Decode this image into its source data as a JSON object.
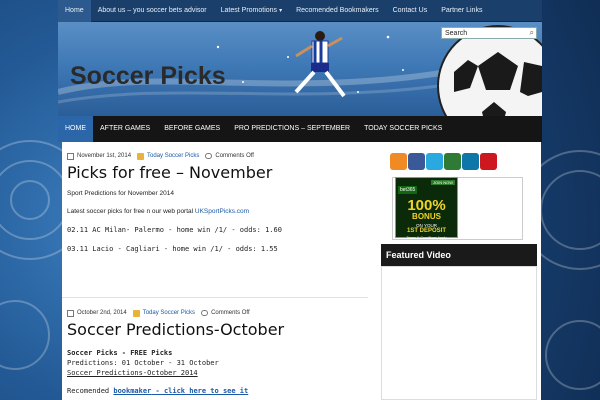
{
  "top_nav": {
    "items": [
      {
        "label": "Home",
        "active": true
      },
      {
        "label": "About us – you soccer bets advisor"
      },
      {
        "label": "Latest Promotions",
        "has_dropdown": true
      },
      {
        "label": "Recomended Bookmakers"
      },
      {
        "label": "Contact Us"
      },
      {
        "label": "Partner Links"
      }
    ]
  },
  "header": {
    "site_title": "Soccer Picks",
    "search_placeholder": "Search"
  },
  "main_nav": {
    "items": [
      {
        "label": "HOME",
        "active": true
      },
      {
        "label": "AFTER GAMES"
      },
      {
        "label": "BEFORE GAMES"
      },
      {
        "label": "PRO PREDICTIONS – SEPTEMBER"
      },
      {
        "label": "TODAY SOCCER PICKS"
      }
    ]
  },
  "posts": [
    {
      "date": "November 1st, 2014",
      "category": "Today Soccer Picks",
      "comments": "Comments Off",
      "title": "Picks for free – November",
      "intro": "Sport Predictions for November 2014",
      "body_prefix": "Latest soccer picks for free n our web portal ",
      "body_link": "UKSportPicks.com",
      "lines": [
        "02.11 AC Milan- Palermo - home win /1/ - odds: 1.60",
        "03.11 Lacio - Cagliari - home win /1/ - odds: 1.55"
      ]
    },
    {
      "date": "October 2nd, 2014",
      "category": "Today Soccer Picks",
      "comments": "Comments Off",
      "title": "Soccer Predictions-October",
      "heading": "Soccer Picks - FREE Picks",
      "line1": "Predictions: 01 October - 31 October",
      "line2": "Soccer Predictions-October 2014",
      "rec_prefix": "Recomended ",
      "rec_link1": "bookmaker",
      "rec_link2": " - click here to see it"
    }
  ],
  "sidebar": {
    "social_icons": [
      "rss-icon",
      "facebook-icon",
      "twitter-icon",
      "google-plus-icon",
      "linkedin-icon",
      "youtube-icon"
    ],
    "banner": {
      "brand": "bet365",
      "cta": "JOIN NOW",
      "headline": "100%",
      "line2": "BONUS",
      "line3": "ON YOUR",
      "line4": "1ST DEPOSIT",
      "fine_print": "Terms & Conditions Apply"
    },
    "featured_video_title": "Featured Video"
  },
  "colors": {
    "accent": "#2b66a8",
    "link": "#1b58a6",
    "nav_bg": "#151515",
    "top_nav_bg": "#1b3f6b"
  }
}
